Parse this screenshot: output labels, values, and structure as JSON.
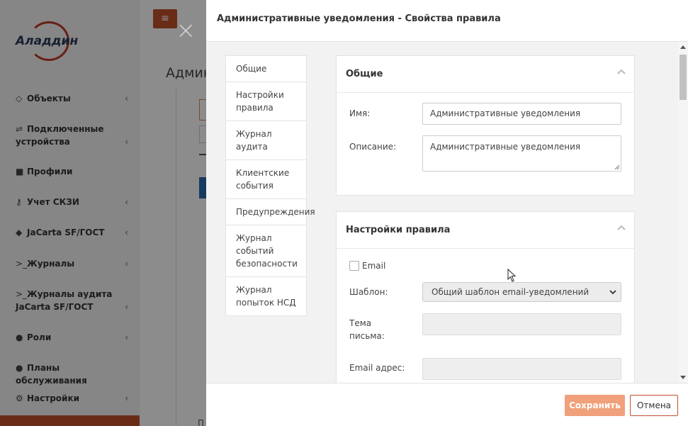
{
  "app": {
    "logo_text": "Аладдин",
    "page_title_partial": "Админ",
    "footer_partial": "П",
    "menu": [
      {
        "label": "Объекты",
        "icon": "diamond-icon",
        "chevron": true
      },
      {
        "label": "Подключенные устройства",
        "icon": "usb-icon",
        "chevron": true
      },
      {
        "label": "Профили",
        "icon": "folder-icon",
        "chevron": false
      },
      {
        "label": "Учет СКЗИ",
        "icon": "key-icon",
        "chevron": true
      },
      {
        "label": "JaCarta SF/ГОСТ",
        "icon": "shield-icon",
        "chevron": true
      },
      {
        "label": "Журналы",
        "icon": "terminal-icon",
        "chevron": true
      },
      {
        "label": "Журналы аудита JaCarta SF/ГОСТ",
        "icon": "terminal-icon",
        "chevron": true
      },
      {
        "label": "Роли",
        "icon": "user-circle-icon",
        "chevron": true
      },
      {
        "label": "Планы обслуживания",
        "icon": "user-circle-icon",
        "chevron": false
      },
      {
        "label": "Настройки",
        "icon": "cogs-icon",
        "chevron": true
      }
    ],
    "hamburger_icon": "≡",
    "close_icon": "×"
  },
  "modal": {
    "title": "Административные уведомления - Свойства правила",
    "nav": [
      "Общие",
      "Настройки правила",
      "Журнал аудита",
      "Клиентские события",
      "Предупреждения",
      "Журнал событий безопасности",
      "Журнал попыток НСД"
    ],
    "general": {
      "title": "Общие",
      "name_label": "Имя:",
      "name_value": "Административные уведомления",
      "description_label": "Описание:",
      "description_value": "Административные уведомления"
    },
    "rule_settings": {
      "title": "Настройки правила",
      "email_checkbox_label": "Email",
      "email_checked": false,
      "template_label": "Шаблон:",
      "template_value": "Общий шаблон email-уведомлений",
      "subject_label": "Тема письма:",
      "subject_value": "",
      "address_label": "Email адрес:",
      "address_value": ""
    },
    "footer": {
      "save_label": "Сохранить",
      "cancel_label": "Отмена"
    }
  },
  "colors": {
    "accent": "#c0502b",
    "save_button": "#f0a07a",
    "logo_ring": "#c0392b"
  }
}
